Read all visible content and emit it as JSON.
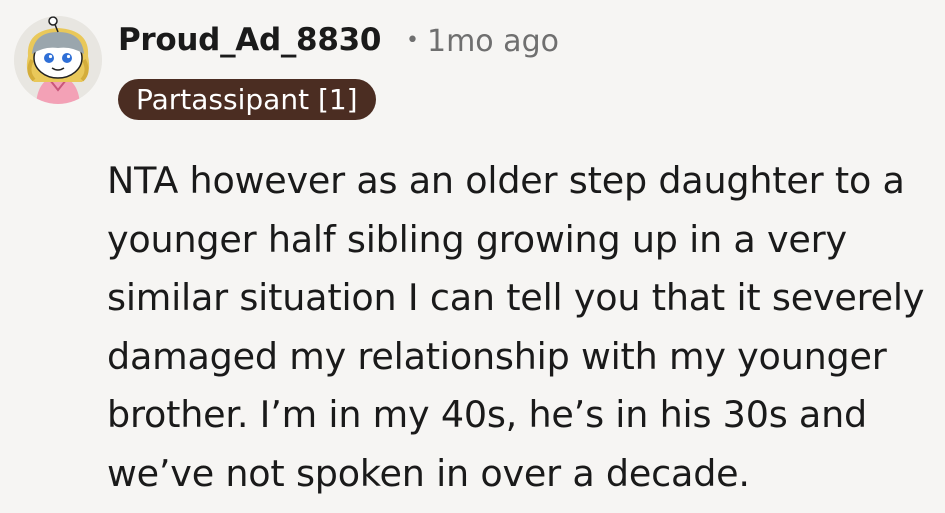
{
  "comment": {
    "username": "Proud_Ad_8830",
    "separator": "•",
    "timestamp": "1mo ago",
    "flair": "Partassipant [1]",
    "avatar_icon": "snoo-avatar-icon",
    "text_lines": [
      "NTA however as an older step daughter to a",
      "younger half sibling growing up in a very",
      "similar situation I can tell you that it severely",
      "damaged my relationship with my younger",
      "brother. I’m in my 40s, he’s in his 30s and",
      "we’ve not spoken in over a decade."
    ]
  },
  "colors": {
    "background": "#f6f5f3",
    "flair_background": "#4b2d22",
    "flair_text": "#ffffff",
    "meta_text": "#6f6f6f",
    "body_text": "#1a1a1a"
  }
}
